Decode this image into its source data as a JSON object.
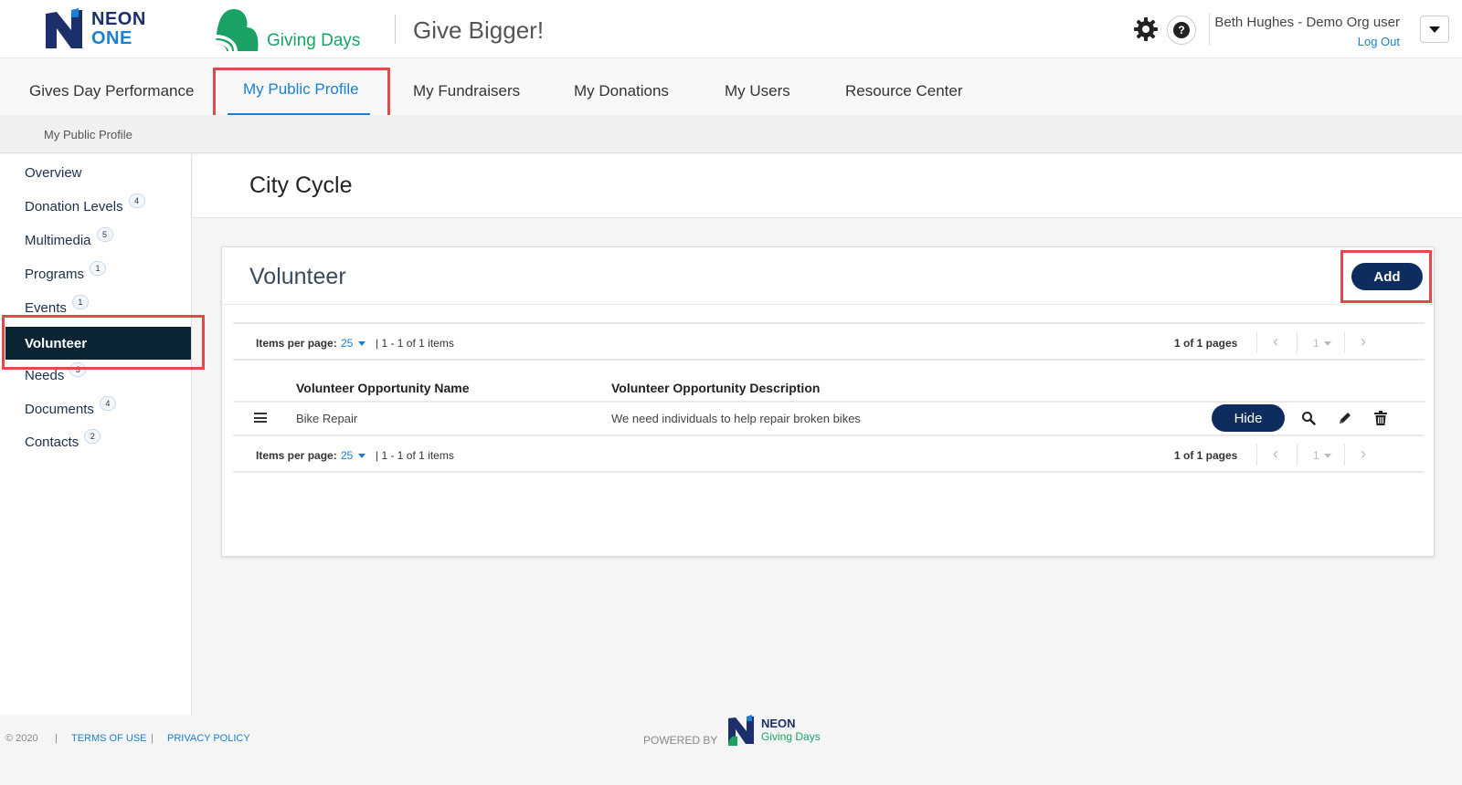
{
  "header": {
    "neon_logo_line1": "NEON",
    "neon_logo_line2": "ONE",
    "giving_days_logo": "Giving Days",
    "tagline": "Give Bigger!",
    "user_name": "Beth Hughes - Demo Org user",
    "logout": "Log Out",
    "help_glyph": "?"
  },
  "nav": {
    "items": [
      {
        "label": "Gives Day Performance"
      },
      {
        "label": "My Public Profile"
      },
      {
        "label": "My Fundraisers"
      },
      {
        "label": "My Donations"
      },
      {
        "label": "My Users"
      },
      {
        "label": "Resource Center"
      }
    ],
    "breadcrumb": "My Public Profile"
  },
  "sidebar": {
    "items": [
      {
        "label": "Overview",
        "badge": ""
      },
      {
        "label": "Donation Levels",
        "badge": "4"
      },
      {
        "label": "Multimedia",
        "badge": "5"
      },
      {
        "label": "Programs",
        "badge": "1"
      },
      {
        "label": "Events",
        "badge": "1"
      },
      {
        "label": "Volunteer",
        "badge": ""
      },
      {
        "label": "Needs",
        "badge": "3"
      },
      {
        "label": "Documents",
        "badge": "4"
      },
      {
        "label": "Contacts",
        "badge": "2"
      }
    ]
  },
  "main": {
    "page_title": "City Cycle",
    "card_title": "Volunteer",
    "add_label": "Add",
    "pager": {
      "items_per_page_label": "Items per page:",
      "items_per_page_value": "25",
      "range": "| 1 - 1 of 1 items",
      "pages": "1 of 1 pages",
      "page_number": "1",
      "prev": "‹",
      "next": "›"
    },
    "table": {
      "columns": [
        "Volunteer Opportunity Name",
        "Volunteer Opportunity Description"
      ],
      "rows": [
        {
          "name": "Bike Repair",
          "description": "We need individuals to help repair broken bikes"
        }
      ],
      "hide_label": "Hide"
    }
  },
  "footer": {
    "copyright": "© 2020",
    "sep": "|",
    "terms": "TERMS OF USE",
    "privacy": "PRIVACY POLICY",
    "powered_by": "POWERED BY",
    "logo_line1": "NEON",
    "logo_line2": "Giving Days"
  },
  "colors": {
    "brand_navy": "#0d2d5e",
    "link_blue": "#1b7fd3",
    "giving_green": "#1aa265",
    "sidebar_active": "#0b2534",
    "highlight_red": "#e04a4a"
  }
}
